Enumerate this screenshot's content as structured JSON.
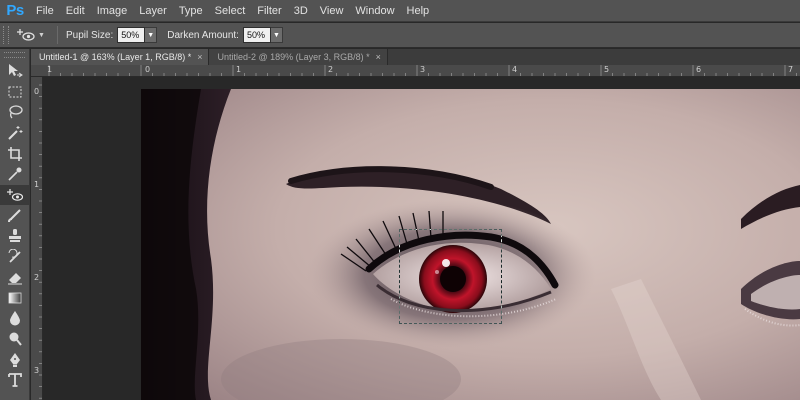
{
  "app": {
    "logo": "Ps"
  },
  "menu": [
    "File",
    "Edit",
    "Image",
    "Layer",
    "Type",
    "Select",
    "Filter",
    "3D",
    "View",
    "Window",
    "Help"
  ],
  "options": {
    "tool_icon": "red-eye-tool-icon",
    "pupil_size_label": "Pupil Size:",
    "pupil_size_value": "50%",
    "darken_amount_label": "Darken Amount:",
    "darken_amount_value": "50%"
  },
  "tabs": [
    {
      "label": "Untitled-1 @ 163% (Layer 1, RGB/8) *",
      "active": true
    },
    {
      "label": "Untitled-2 @ 189% (Layer 3, RGB/8) *",
      "active": false
    }
  ],
  "ruler_top_labels": [
    "1",
    "0",
    "1",
    "2",
    "3",
    "4",
    "5",
    "6",
    "7"
  ],
  "ruler_left_labels": [
    "0",
    "1",
    "2",
    "3"
  ],
  "tools": [
    "move-tool-icon",
    "marquee-tool-icon",
    "lasso-tool-icon",
    "magic-wand-icon",
    "crop-tool-icon",
    "eyedropper-icon",
    "red-eye-tool-icon",
    "brush-tool-icon",
    "clone-stamp-icon",
    "history-brush-icon",
    "eraser-icon",
    "gradient-tool-icon",
    "blur-tool-icon",
    "dodge-tool-icon",
    "pen-tool-icon",
    "type-tool-icon"
  ],
  "colors": {
    "menubar": "#535353",
    "workspace": "#282828",
    "accent": "#31a8ff",
    "iris": "#c0142a"
  }
}
